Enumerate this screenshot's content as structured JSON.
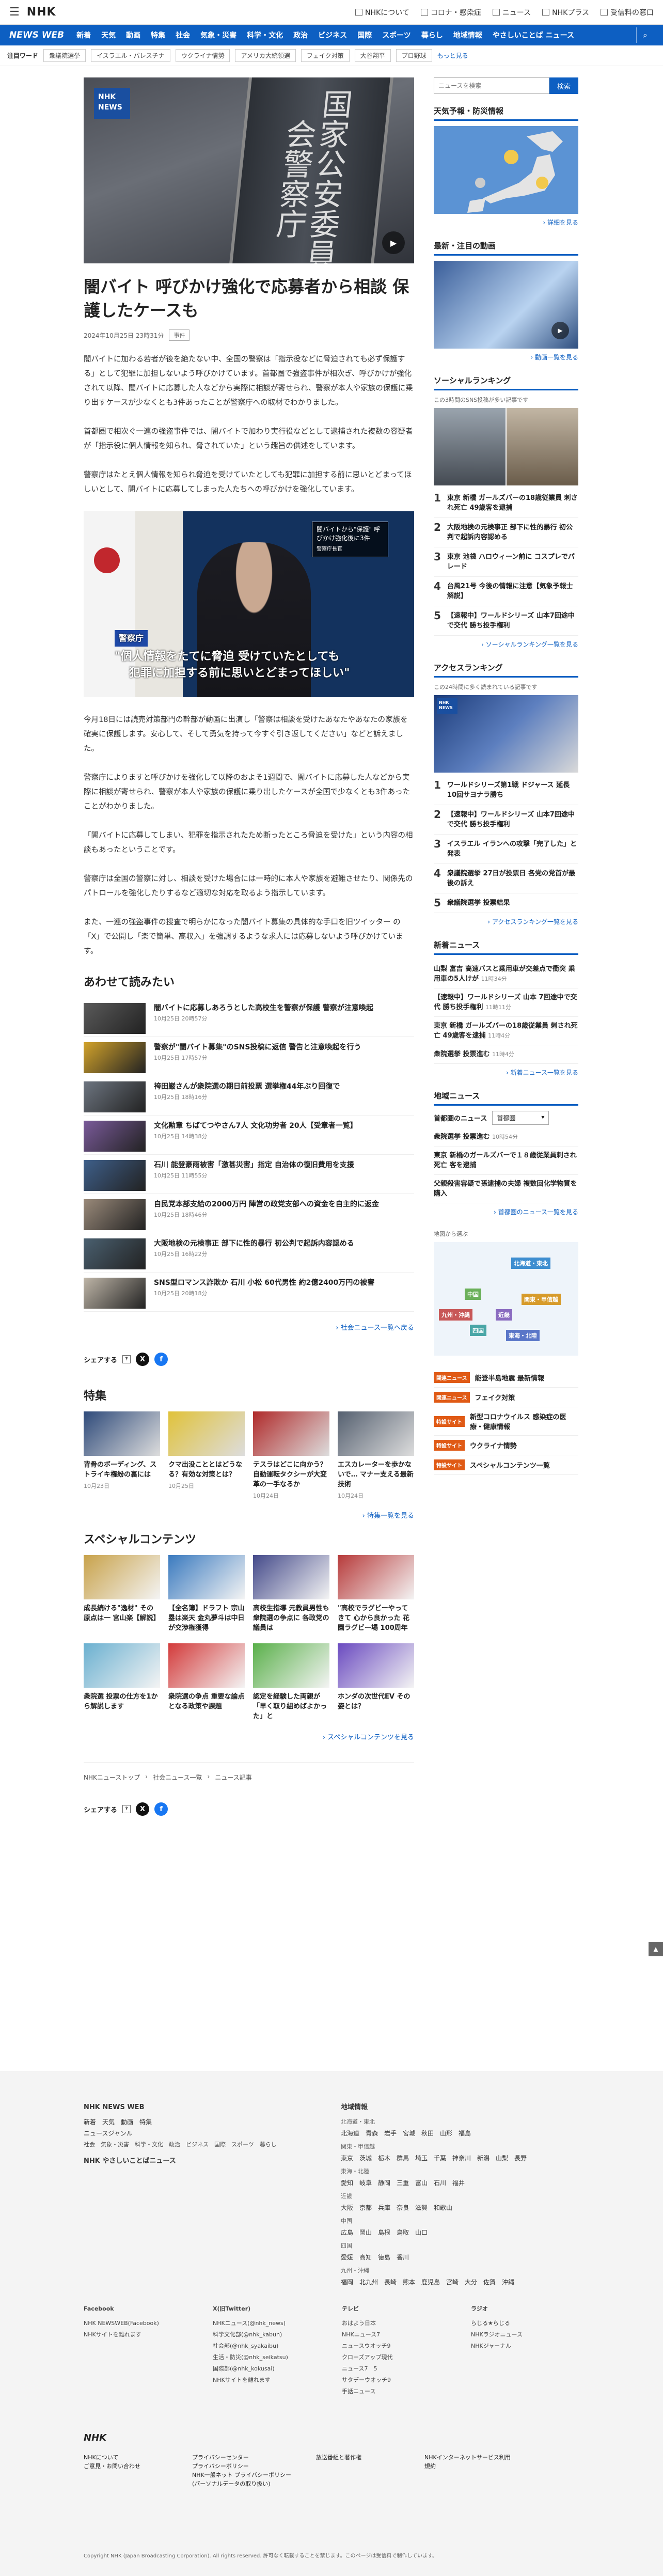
{
  "top": {
    "logo": "NHK",
    "links": [
      "NHKについて",
      "コロナ・感染症",
      "ニュース",
      "NHKプラス",
      "受信料の窓口"
    ]
  },
  "nav": {
    "brand": "NEWS WEB",
    "items": [
      "新着",
      "天気",
      "動画",
      "特集",
      "社会",
      "気象・災害",
      "科学・文化",
      "政治",
      "ビジネス",
      "国際",
      "スポーツ",
      "暮らし",
      "地域情報",
      "やさしいことば ニュース"
    ]
  },
  "keywords": {
    "label": "注目ワード",
    "tags": [
      "衆議院選挙",
      "イスラエル・パレスチナ",
      "ウクライナ情勢",
      "アメリカ大統領選",
      "フェイク対策",
      "大谷翔平",
      "プロ野球"
    ],
    "more": "もっと見る"
  },
  "article": {
    "hero_plate": "国家公安委員会警察庁",
    "badge": "NHK NEWS",
    "title": "闇バイト 呼びかけ強化で応募者から相談 保護したケースも",
    "date": "2024年10月25日 23時31分",
    "category": "事件",
    "paragraphs": [
      "闇バイトに加わる若者が後を絶たない中、全国の警察は「指示役などに脅迫されても必ず保護する」として犯罪に加担しないよう呼びかけています。首都圏で強盗事件が相次ぎ、呼びかけが強化されて以降、闇バイトに応募した人などから実際に相談が寄せられ、警察が本人や家族の保護に乗り出すケースが少なくとも3件あったことが警察庁への取材でわかりました。",
      "首都圏で相次ぐ一連の強盗事件では、闇バイトで加わり実行役などとして逮捕された複数の容疑者が「指示役に個人情報を知られ、脅されていた」という趣旨の供述をしています。",
      "警察庁はたとえ個人情報を知られ脅迫を受けていたとしても犯罪に加担する前に思いとどまってほしいとして、闇バイトに応募してしまった人たちへの呼びかけを強化しています。"
    ],
    "photo2": {
      "box": "闇バイトから\"保護\" 呼びかけ強化後に3件",
      "box_sub": "警察庁長官",
      "cap_top": "警察庁",
      "cap_line1": "\"個人情報をたてに脅迫 受けていたとしても",
      "cap_line2": "犯罪に加担する前に思いとどまってほしい\""
    },
    "paragraphs2": [
      "今月18日には読売対策部門の幹部が動画に出演し「警察は相談を受けたあなたやあなたの家族を確実に保護します。安心して、そして勇気を持って今すぐ引き返してください」などと訴えました。",
      "警察庁によりますと呼びかけを強化して以降のおよそ1週間で、闇バイトに応募した人などから実際に相談が寄せられ、警察が本人や家族の保護に乗り出したケースが全国で少なくとも3件あったことがわかりました。",
      "「闇バイトに応募してしまい、犯罪を指示されたため断ったところ脅迫を受けた」という内容の相談もあったということです。",
      "警察庁は全国の警察に対し、相談を受けた場合には一時的に本人や家族を避難させたり、関係先のパトロールを強化したりするなど適切な対応を取るよう指示しています。",
      "また、一連の強盗事件の捜査で明らかになった闇バイト募集の具体的な手口を旧ツイッター の「X」で公開し「楽で簡単、高収入」を強調するような求人には応募しないよう呼びかけています。"
    ]
  },
  "related": {
    "title": "あわせて読みたい",
    "items": [
      {
        "t": "闇バイトに応募しあろうとした高校生を警察が保護 警察が注意喚起",
        "d": "10月25日 20時57分"
      },
      {
        "t": "警察が\"闇バイト募集\"のSNS投稿に返信 警告と注意喚起を行う",
        "d": "10月25日 17時57分"
      },
      {
        "t": "袴田巌さんが衆院選の期日前投票 選挙権44年ぶり回復で",
        "d": "10月25日 18時16分"
      },
      {
        "t": "文化勲章 ちばてつやさん7人 文化功労者 20人【受章者一覧】",
        "d": "10月25日 14時38分"
      },
      {
        "t": "石川 能登豪雨被害「激甚災害」指定 自治体の復旧費用を支援",
        "d": "10月25日 11時55分"
      },
      {
        "t": "自民党本部支給の2000万円 陣営の政党支部への資金を自主的に返金",
        "d": "10月25日 18時46分"
      },
      {
        "t": "大阪地検の元検事正 部下に性的暴行 初公判で起訴内容認める",
        "d": "10月25日 16時22分"
      },
      {
        "t": "SNS型ロマンス詐欺か 石川 小松 60代男性 約2億2400万円の被害",
        "d": "10月25日 20時18分"
      }
    ],
    "more": "社会ニュース一覧へ戻る"
  },
  "share_label": "シェアする",
  "special": {
    "title": "特集",
    "items": [
      {
        "t": "背骨のボーディング、ストライキ権紛の裏には",
        "d": "10月23日"
      },
      {
        "t": "クマ出没こととはどうなる？有効な対策とは？",
        "d": "10月25日"
      },
      {
        "t": "テスラはどこに向かう？自動運転タクシーが大変革の一手なるか",
        "d": "10月24日"
      },
      {
        "t": "エスカレーターを歩かないで… マナー支える最新技術",
        "d": "10月24日"
      }
    ],
    "more": "特集一覧を見る"
  },
  "contents": {
    "title": "スペシャルコンテンツ",
    "items": [
      {
        "t": "成長続ける\"逸材\" その原点は一 宮山楽【解説】"
      },
      {
        "t": "【全名簿】ドラフト 宗山塁は楽天 金丸夢斗は中日が交渉権獲得"
      },
      {
        "t": "高校生指導 元教員男性も 衆院選の争点に 各政党の議員は"
      },
      {
        "t": "\"高校でラグビーやってきて 心から良かった 花園ラグビー場 100周年"
      },
      {
        "t": "衆院選 投票の仕方を1から解説します"
      },
      {
        "t": "衆院選の争点 重要な論点となる政策や課題"
      },
      {
        "t": "認定を経験した両親が「早く取り組めばよかった」と"
      },
      {
        "t": "ホンダの次世代EV その姿とは？"
      }
    ],
    "more": "スペシャルコンテンツを見る"
  },
  "breadcrumb": [
    "NHKニューストップ",
    "社会ニュース一覧",
    "ニュース記事"
  ],
  "sidebar": {
    "search_placeholder": "ニュースを検索",
    "search_button": "検索",
    "weather_title": "天気予報・防災情報",
    "weather_more": "詳細を見る",
    "video_title": "最新・注目の動画",
    "video_more": "動画一覧を見る",
    "social_title": "ソーシャルランキング",
    "social_sub": "この3時間のSNS投稿が多い記事です",
    "social_items": [
      "東京 新橋 ガールズバーの18歳従業員 刺され死亡 49歳客を逮捕",
      "大阪地検の元検事正 部下に性的暴行 初公判で起訴内容認める",
      "東京 池袋 ハロウィーン前に コスプレでパレード",
      "台風21号 今後の情報に注意【気象予報士解説】",
      "【速報中】ワールドシリーズ 山本7回途中で交代 勝ち投手権利"
    ],
    "social_more": "ソーシャルランキング一覧を見る",
    "access_title": "アクセスランキング",
    "access_sub": "この24時間に多く読まれている記事です",
    "access_items": [
      "ワールドシリーズ第1戦 ドジャース 延長10回サヨナラ勝ち",
      "【速報中】ワールドシリーズ 山本7回途中で交代 勝ち投手権利",
      "イスラエル イランへの攻撃「完了した」と発表",
      "衆議院選挙 27日が投票日 各党の党首が最後の訴え",
      "衆議院選挙 投票結果"
    ],
    "access_more": "アクセスランキング一覧を見る",
    "new_title": "新着ニュース",
    "new_items": [
      {
        "t": "山梨 富吉 高速バスと乗用車が交差点で衝突 乗用車の5人けが",
        "tm": "11時34分"
      },
      {
        "t": "【速報中】ワールドシリーズ 山本 7回途中で交代 勝ち投手権利",
        "tm": "11時11分"
      },
      {
        "t": "東京 新橋 ガールズバーの18歳従業員 刺され死亡 49歳客を逮捕",
        "tm": "11時4分"
      },
      {
        "t": "衆院選挙 投票進む",
        "tm": "11時4分"
      }
    ],
    "new_more": "新着ニュース一覧を見る",
    "local_title": "地域ニュース",
    "local_label": "首都圏のニュース",
    "local_select": "首都圏",
    "local_items": [
      {
        "t": "衆院選挙 投票進む",
        "tm": "10時54分"
      },
      {
        "t": "東京 新橋のガールズバーで１８歳従業員刺され死亡 客を逮捕",
        "tm": ""
      },
      {
        "t": "父親殺害容疑で孫逮捕の夫婦 複数回化学物質を購入",
        "tm": ""
      }
    ],
    "local_more": "首都圏のニュース一覧を見る",
    "map_caption": "地図から選ぶ",
    "regions": [
      "北海道・東北",
      "中国",
      "関東・甲信越",
      "九州・沖縄",
      "四国",
      "近畿",
      "東海・北陸"
    ],
    "spec_items": [
      {
        "b": "関連ニュース",
        "t": "能登半島地震 最新情報"
      },
      {
        "b": "関連ニュース",
        "t": "フェイク対策"
      },
      {
        "b": "特設サイト",
        "t": "新型コロナウイルス 感染症の医療・健康情報"
      },
      {
        "b": "特設サイト",
        "t": "ウクライナ情勢"
      },
      {
        "b": "特設サイト",
        "t": "スペシャルコンテンツ一覧"
      }
    ]
  },
  "footer": {
    "newsweb_title": "NHK NEWS WEB",
    "newsweb_row1": "新着　天気　動画　特集",
    "newsweb_row2": "ニュースジャンル",
    "newsweb_row3": "社会　気象・災害　科学・文化　政治　ビジネス　国際　スポーツ　暮らし",
    "easy": "NHK やさしいことばニュース",
    "region_title": "地域情報",
    "region_rows": [
      "北海道・東北",
      "北海道　青森　岩手　宮城　秋田　山形　福島",
      "関東・甲信越",
      "東京　茨城　栃木　群馬　埼玉　千葉　神奈川　新潟　山梨　長野",
      "東海・北陸",
      "愛知　岐阜　静岡　三重　富山　石川　福井",
      "近畿",
      "大阪　京都　兵庫　奈良　滋賀　和歌山",
      "中国",
      "広島　岡山　島根　鳥取　山口",
      "四国",
      "愛媛　高知　徳島　香川",
      "九州・沖縄",
      "福岡　北九州　長崎　熊本　鹿児島　宮崎　大分　佐賀　沖縄"
    ],
    "cols": [
      {
        "h": "Facebook",
        "items": [
          "NHK NEWSWEB(Facebook)",
          "NHKサイトを離れます"
        ]
      },
      {
        "h": "X(旧Twitter)",
        "items": [
          "NHKニュース(@nhk_news)",
          "科学文化部(@nhk_kabun)",
          "社会部(@nhk_syakaibu)",
          "生活・防災(@nhk_seikatsu)",
          "国際部(@nhk_kokusai)",
          "NHKサイトを離れます"
        ]
      },
      {
        "h": "テレビ",
        "items": [
          "おはよう日本",
          "NHKニュース7",
          "ニュースウオッチ9",
          "クローズアップ現代",
          "ニュース7　5",
          "サタデーウオッチ9",
          "手話ニュース"
        ]
      },
      {
        "h": "ラジオ",
        "items": [
          "らじる★らじる",
          "NHKラジオニュース",
          "NHKジャーナル"
        ]
      }
    ],
    "logo": "NHK",
    "bottom_cols": [
      [
        "NHKについて",
        "ご意見・お問い合わせ"
      ],
      [
        "プライバシーセンター",
        "プライバシーポリシー",
        "NHK一般ネット プライバシーポリシー(パーソナルデータの取り扱い)"
      ],
      [
        "放送番組と著作権"
      ],
      [
        "NHKインターネットサービス利用規約"
      ]
    ],
    "copyright": "Copyright NHK (Japan Broadcasting Corporation). All rights reserved. 許可なく転載することを禁じます。このページは受信料で制作しています。"
  }
}
